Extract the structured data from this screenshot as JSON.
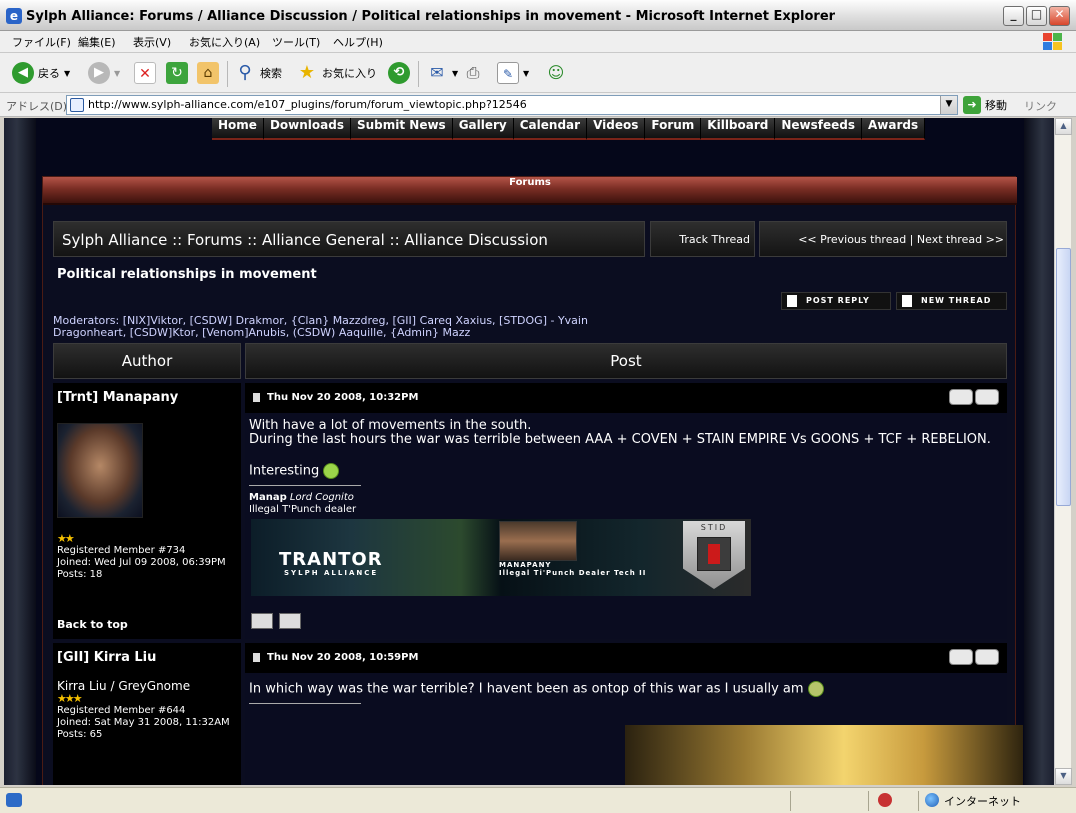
{
  "window": {
    "title": "Sylph Alliance: Forums / Alliance Discussion / Political relationships in movement - Microsoft Internet Explorer",
    "min": "_",
    "max": "□",
    "close": "✕"
  },
  "menu": [
    "ファイル(F)",
    "編集(E)",
    "表示(V)",
    "お気に入り(A)",
    "ツール(T)",
    "ヘルプ(H)"
  ],
  "toolbar": {
    "back": "戻る",
    "search": "検索",
    "favorites": "お気に入り"
  },
  "address": {
    "label": "アドレス(D)",
    "url": "http://www.sylph-alliance.com/e107_plugins/forum/forum_viewtopic.php?12546",
    "go": "移動",
    "links": "リンク"
  },
  "status": {
    "zone": "インターネット"
  },
  "site": {
    "nav": [
      "Home",
      "Downloads",
      "Submit News",
      "Gallery",
      "Calendar",
      "Videos",
      "Forum",
      "Killboard",
      "Newsfeeds",
      "Awards"
    ],
    "panel_title": "Forums"
  },
  "forum": {
    "breadcrumb": "Sylph Alliance :: Forums :: Alliance General :: Alliance Discussion",
    "track": "Track Thread",
    "prevnext": "<< Previous thread | Next thread >>",
    "thread_title": "Political relationships in movement",
    "post_reply": "POST REPLY",
    "new_thread": "NEW THREAD",
    "moderators": "Moderators: [NIX]Viktor, [CSDW] Drakmor, {Clan} Mazzdreg, [GII] Careq Xaxius, [STDOG] - Yvain Dragonheart, [CSDW]Ktor, [Venom]Anubis, (CSDW) Aaquille, {Admin} Mazz",
    "col_author": "Author",
    "col_post": "Post",
    "back_to_top": "Back to top"
  },
  "posts": [
    {
      "author": "[Trnt] Manapany",
      "date": "Thu Nov 20 2008, 10:32PM",
      "stars": "★★",
      "member": "Registered Member #734",
      "joined": "Joined: Wed Jul 09 2008, 06:39PM",
      "posts": "Posts: 18",
      "body_line1": "With have a lot of movements in the south.",
      "body_line2": "During the last hours the war was terrible between AAA + COVEN + STAIN EMPIRE Vs GOONS + TCF + REBELION.",
      "body_line3": "Interesting",
      "sig_name": "Manap",
      "sig_title": "Lord Cognito",
      "sig_line2": "Illegal T'Punch dealer",
      "banner_trantor": "TRANTOR",
      "banner_alliance": "SYLPH ALLIANCE",
      "banner_name": "MANAPANY",
      "banner_sub": "Illegal Ti'Punch Dealer Tech II",
      "banner_stid": "STID"
    },
    {
      "author": "[GII] Kirra Liu",
      "date": "Thu Nov 20 2008, 10:59PM",
      "alias": "Kirra Liu / GreyGnome",
      "stars": "★★★",
      "member": "Registered Member #644",
      "joined": "Joined: Sat May 31 2008, 11:32AM",
      "posts": "Posts: 65",
      "body_line1": "In which way was the war terrible? I havent been as ontop of this war as I usually am"
    }
  ]
}
